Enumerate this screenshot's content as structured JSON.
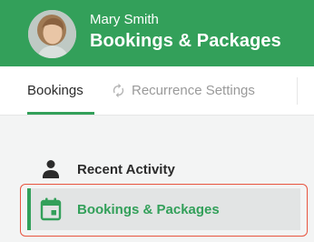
{
  "header": {
    "user_name": "Mary Smith",
    "title": "Bookings & Packages",
    "avatar_icon": "user-avatar-photo"
  },
  "tabs": [
    {
      "label": "Bookings",
      "active": true
    },
    {
      "label": "Recurrence Settings",
      "active": false,
      "icon": "refresh-icon"
    }
  ],
  "menu": {
    "items": [
      {
        "label": "Recent Activity",
        "icon": "person-icon",
        "selected": false
      },
      {
        "label": "Bookings & Packages",
        "icon": "calendar-icon",
        "selected": true
      }
    ]
  },
  "colors": {
    "brand_green": "#33a05a",
    "highlight_outline": "#e8543f"
  }
}
